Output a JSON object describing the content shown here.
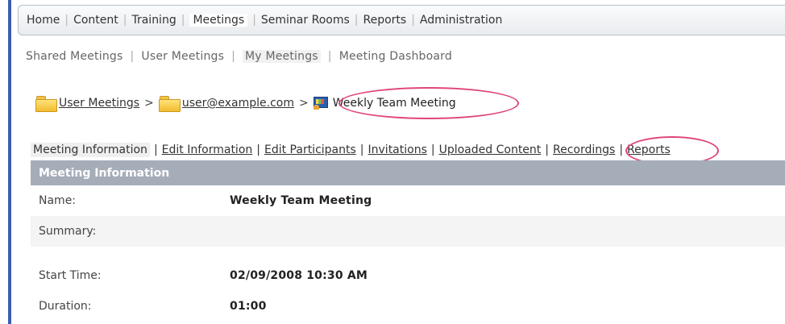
{
  "top_nav": {
    "items": [
      {
        "label": "Home"
      },
      {
        "label": "Content"
      },
      {
        "label": "Training"
      },
      {
        "label": "Meetings"
      },
      {
        "label": "Seminar Rooms"
      },
      {
        "label": "Reports"
      },
      {
        "label": "Administration"
      }
    ],
    "active": "Meetings"
  },
  "sub_nav": {
    "items": [
      {
        "label": "Shared Meetings"
      },
      {
        "label": "User Meetings"
      },
      {
        "label": "My Meetings"
      },
      {
        "label": "Meeting Dashboard"
      }
    ],
    "active": "My Meetings"
  },
  "breadcrumb": {
    "items": [
      {
        "label": "User Meetings",
        "icon": "folder-icon"
      },
      {
        "label": "user@example.com",
        "icon": "folder-icon"
      }
    ],
    "separator": ">",
    "current": {
      "label": "Weekly Team Meeting",
      "icon": "meeting-icon"
    }
  },
  "tabs": {
    "active": "Meeting Information",
    "links": [
      {
        "label": "Edit Information"
      },
      {
        "label": "Edit Participants"
      },
      {
        "label": "Invitations"
      },
      {
        "label": "Uploaded Content"
      },
      {
        "label": "Recordings"
      },
      {
        "label": "Reports"
      }
    ]
  },
  "section": {
    "title": "Meeting Information"
  },
  "info": {
    "rows": [
      {
        "label": "Name:",
        "value": "Weekly Team Meeting"
      },
      {
        "label": "Summary:",
        "value": ""
      },
      {
        "label": "Start Time:",
        "value": "02/09/2008 10:30 AM"
      },
      {
        "label": "Duration:",
        "value": "01:00"
      }
    ]
  },
  "colors": {
    "highlight_oval": "#e0457a",
    "section_header": "#a5adb9",
    "left_rule": "#3b5eb0"
  }
}
